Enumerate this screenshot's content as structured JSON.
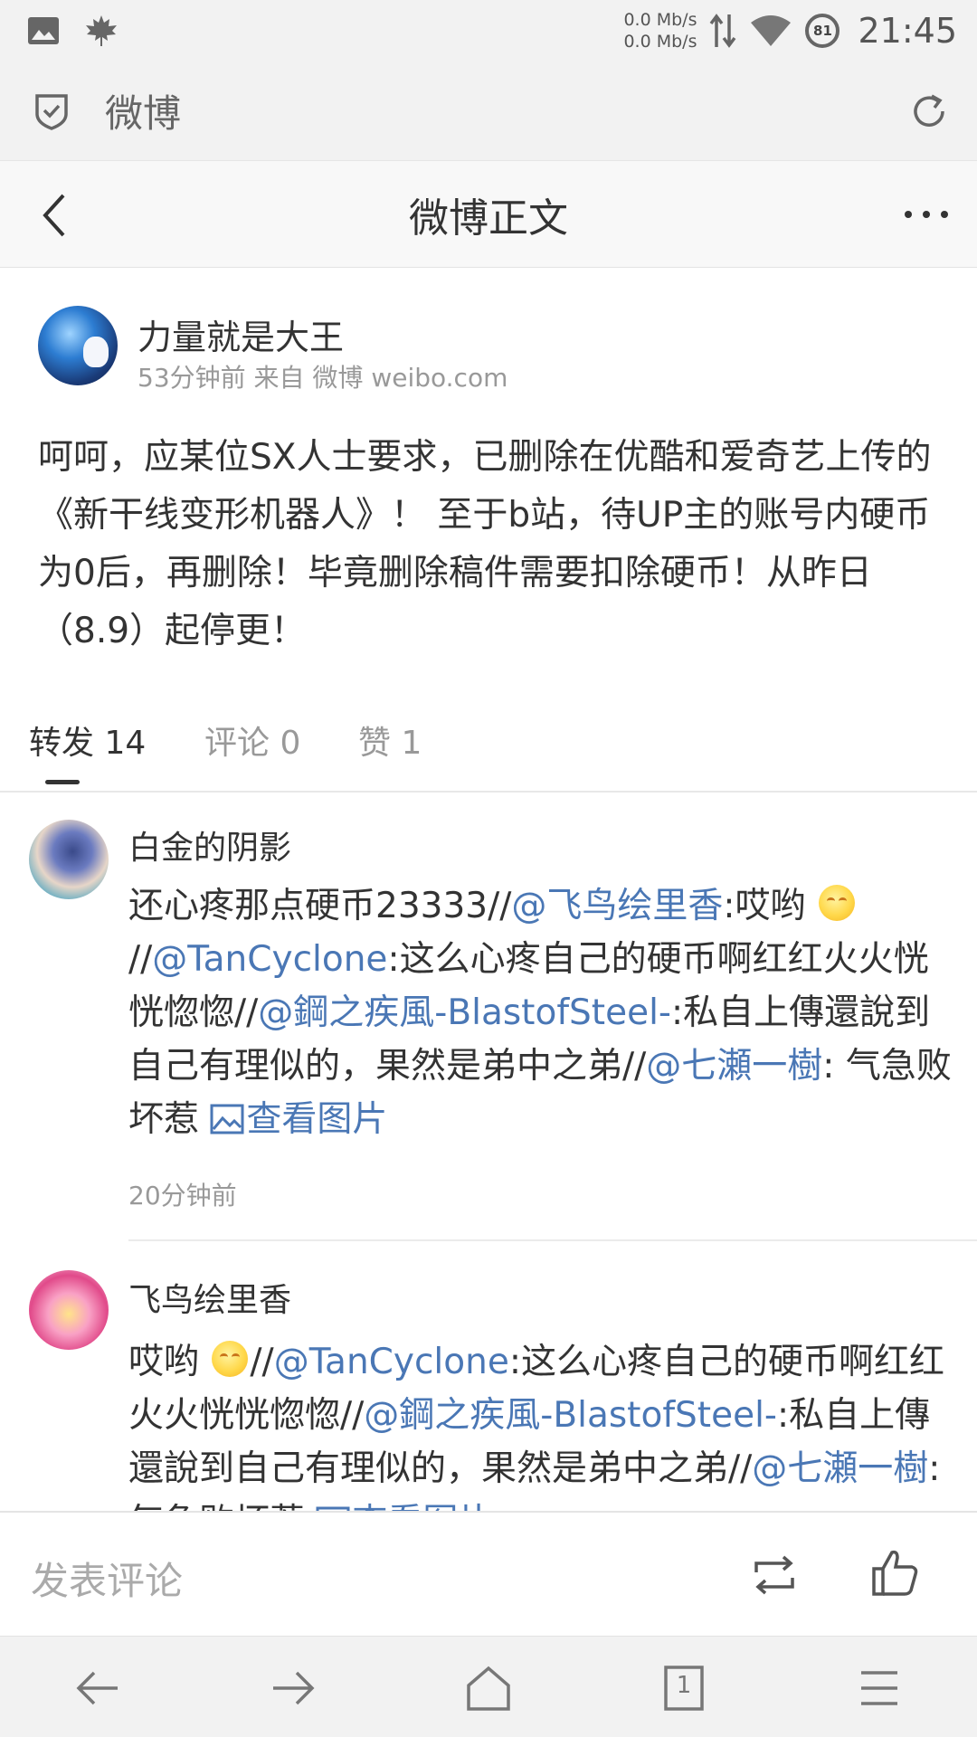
{
  "status_bar": {
    "net_up": "0.0 Mb/s",
    "net_down": "0.0 Mb/s",
    "battery": "81",
    "time": "21:45"
  },
  "browser": {
    "title": "微博"
  },
  "header": {
    "title": "微博正文"
  },
  "post": {
    "author": "力量就是大王",
    "meta": "53分钟前 来自 微博 weibo.com",
    "text": "呵呵，应某位SX人士要求，已删除在优酷和爱奇艺上传的《新干线变形机器人》！ 至于b站，待UP主的账号内硬币为0后，再删除！毕竟删除稿件需要扣除硬币！从昨日（8.9）起停更！"
  },
  "tabs": [
    {
      "label": "转发 14"
    },
    {
      "label": "评论 0"
    },
    {
      "label": "赞 1"
    }
  ],
  "reposts": [
    {
      "name": "白金的阴影",
      "text_1": "还心疼那点硬币23333//",
      "mention_1": "@飞鸟绘里香",
      "text_2": ":哎哟 ",
      "text_3": "//",
      "mention_2": "@TanCyclone",
      "text_4": ":这么心疼自己的硬币啊红红火火恍恍惚惚//",
      "mention_3": "@鋼之疾風-BlastofSteel-",
      "text_5": ":私自上傳還說到自己有理似的，果然是弟中之弟//",
      "mention_4": "@七瀬一樹",
      "text_6": ": 气急败坏惹 ",
      "image_link": "查看图片",
      "time": "20分钟前"
    },
    {
      "name": "飞鸟绘里香",
      "text_1": "哎哟 ",
      "text_2": "//",
      "mention_1": "@TanCyclone",
      "text_3": ":这么心疼自己的硬币啊红红火火恍恍惚惚//",
      "mention_2": "@鋼之疾風-BlastofSteel-",
      "text_4": ":私自上傳還說到自己有理似的，果然是弟中之弟//",
      "mention_3": "@七瀬一樹",
      "text_5": ": 气急败坏惹 ",
      "image_link": "查看图片"
    }
  ],
  "comment_bar": {
    "placeholder": "发表评论"
  },
  "nav": {
    "tab_count": "1"
  },
  "colors": {
    "mention": "#4a77b5",
    "text": "#333333",
    "muted": "#999999",
    "bar_bg": "#f2f2f2"
  },
  "icons": [
    "image-icon",
    "maple-leaf-icon",
    "data-arrows-icon",
    "wifi-icon",
    "shield-check-icon",
    "refresh-icon",
    "back-chevron-icon",
    "more-dots-icon",
    "emoji-icon",
    "picture-icon",
    "repost-icon",
    "thumbs-up-icon",
    "nav-back-icon",
    "nav-forward-icon",
    "home-icon",
    "tabs-icon",
    "menu-icon"
  ]
}
